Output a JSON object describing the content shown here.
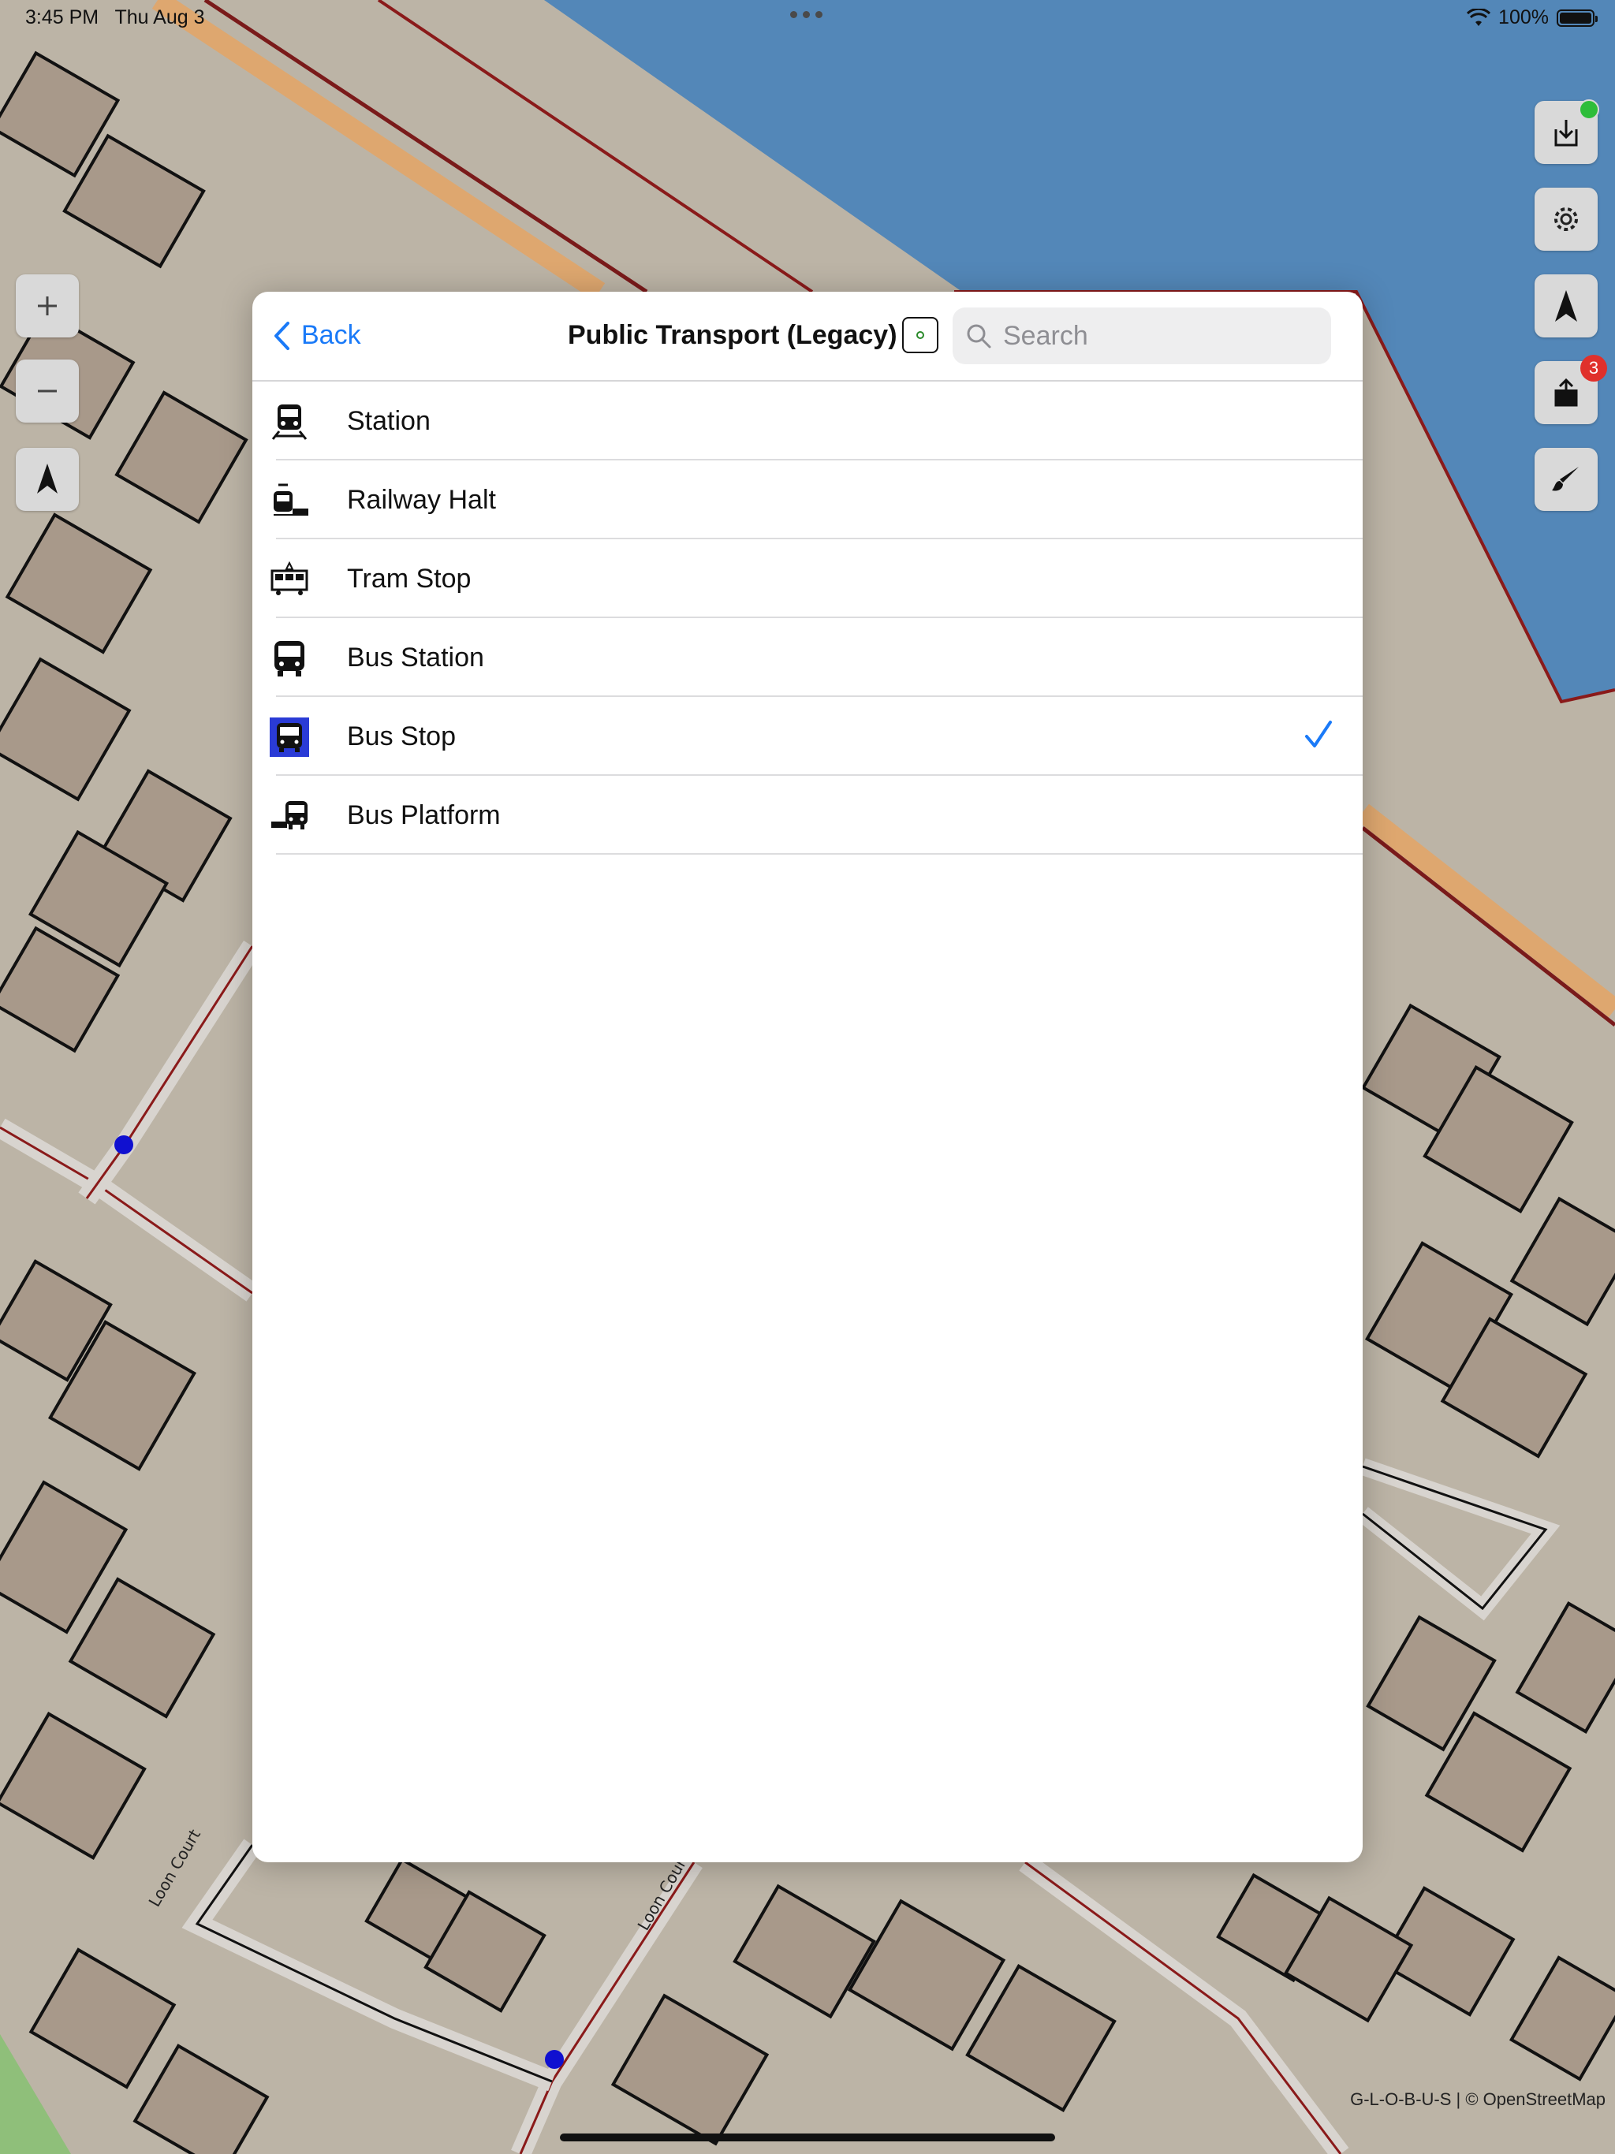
{
  "status_bar": {
    "time": "3:45 PM",
    "date": "Thu Aug 3",
    "battery": "100%",
    "battery_level": 1.0
  },
  "panel": {
    "back_label": "Back",
    "title": "Public Transport (Legacy)",
    "search": {
      "placeholder": "Search",
      "value": ""
    },
    "items": [
      {
        "label": "Station",
        "icon": "train-station-icon",
        "selected": false
      },
      {
        "label": "Railway Halt",
        "icon": "railway-halt-icon",
        "selected": false
      },
      {
        "label": "Tram Stop",
        "icon": "tram-icon",
        "selected": false
      },
      {
        "label": "Bus Station",
        "icon": "bus-station-icon",
        "selected": false
      },
      {
        "label": "Bus Stop",
        "icon": "bus-stop-icon",
        "selected": true
      },
      {
        "label": "Bus Platform",
        "icon": "bus-platform-icon",
        "selected": false
      }
    ]
  },
  "map_controls": {
    "left": [
      "zoom-in-icon",
      "zoom-out-icon",
      "north-arrow-icon"
    ],
    "right": [
      {
        "icon": "download-icon",
        "badge": "green-dot"
      },
      {
        "icon": "gear-icon"
      },
      {
        "icon": "location-arrow-icon"
      },
      {
        "icon": "upload-icon",
        "badge_count": "3"
      },
      {
        "icon": "paintbrush-icon"
      }
    ]
  },
  "map": {
    "street_labels": [
      "Loon Court",
      "Loon Cour"
    ],
    "attribution": "G-L-O-B-U-S | © OpenStreetMap"
  },
  "colors": {
    "accent": "#1a7af8",
    "water": "#5387b8",
    "land": "#bcb4a6",
    "building": "#a8998a",
    "highlight": "#2a3bd6",
    "badge_red": "#e0302b"
  }
}
